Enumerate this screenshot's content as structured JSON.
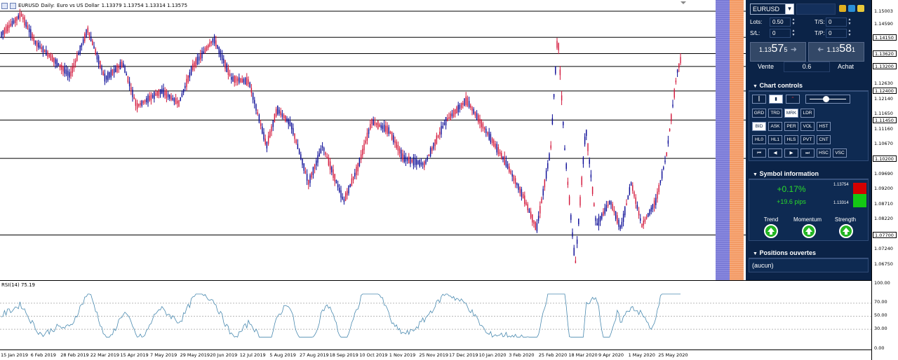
{
  "header": {
    "symbol": "EURUSD",
    "timeframe": "Daily:",
    "description": "Euro vs US Dollar",
    "ohlc": "1.13379 1.13754 1.13314 1.13575"
  },
  "price_axis": {
    "ticks": [
      "1.15003",
      "1.14590",
      "1.14150",
      "1.13620",
      "1.13200",
      "1.12630",
      "1.12400",
      "1.12140",
      "1.11650",
      "1.11450",
      "1.11160",
      "1.10670",
      "1.10200",
      "1.09690",
      "1.09200",
      "1.08710",
      "1.08220",
      "1.07700",
      "1.07240",
      "1.06750"
    ],
    "flagged": [
      "1.14150",
      "1.13620",
      "1.13200",
      "1.12400",
      "1.11450",
      "1.10200",
      "1.07700"
    ]
  },
  "rsi": {
    "label": "RSI(14) 75.19",
    "ticks": [
      "100.00",
      "70.00",
      "50.00",
      "30.00",
      "0.00"
    ]
  },
  "time_axis": [
    "15 Jan 2019",
    "6 Feb 2019",
    "28 Feb 2019",
    "22 Mar 2019",
    "15 Apr 2019",
    "7 May 2019",
    "29 May 2019",
    "20 Jun 2019",
    "12 Jul 2019",
    "5 Aug 2019",
    "27 Aug 2019",
    "18 Sep 2019",
    "10 Oct 2019",
    "1 Nov 2019",
    "25 Nov 2019",
    "17 Dec 2019",
    "10 Jan 2020",
    "3 Feb 2020",
    "25 Feb 2020",
    "18 Mar 2020",
    "9 Apr 2020",
    "1 May 2020",
    "25 May 2020"
  ],
  "panel": {
    "symbol": "EURUSD",
    "lots_label": "Lots:",
    "lots_value": "0.50",
    "sl_label": "S/L:",
    "sl_value": "0",
    "ts_label": "T/S:",
    "ts_value": "0",
    "tp_label": "T/P:",
    "tp_value": "0",
    "sell_price_prefix": "1.13",
    "sell_price_big": "57",
    "sell_price_suffix": "5",
    "buy_price_prefix": "1.13",
    "buy_price_big": "58",
    "buy_price_suffix": "1",
    "sell_label": "Vente",
    "buy_label": "Achat",
    "spread": "0.6",
    "chart_controls_title": "Chart controls",
    "cc_row2": [
      "GRD",
      "TRD",
      "MRK",
      "LDR"
    ],
    "cc_row3": [
      "BID",
      "ASK",
      "PER",
      "VOL",
      "HST"
    ],
    "cc_row4": [
      "HL0",
      "HL1",
      "HLS",
      "PVT",
      "CNT"
    ],
    "cc_row5_right": [
      "HSC",
      "VSC"
    ],
    "symbol_info_title": "Symbol information",
    "change_pct": "+0.17%",
    "change_pips": "+19.6 pips",
    "high": "1.13754",
    "low": "1.13314",
    "trend_label": "Trend",
    "momentum_label": "Momentum",
    "strength_label": "Strength",
    "positions_title": "Positions ouvertes",
    "positions_value": "(aucun)"
  },
  "colors": {
    "bull": "#0a0a96",
    "bear": "#d3163a",
    "panel_bg": "#0b2347",
    "up_green": "#22b522",
    "high_red": "#d40000",
    "low_green": "#14c814"
  }
}
